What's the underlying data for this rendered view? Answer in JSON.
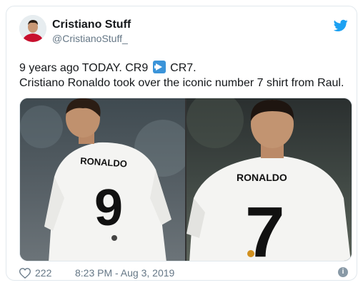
{
  "tweet": {
    "author_name": "Cristiano Stuff",
    "author_handle": "@CristianoStuff_",
    "text_line1_before": "9 years ago TODAY. CR9 ",
    "text_line1_after": " CR7.",
    "text_line2": "Cristiano Ronaldo took over the iconic number 7 shirt from Raul.",
    "emoji": "right-arrow-emoji",
    "likes": "222",
    "timestamp": "8:23 PM - Aug 3, 2019"
  },
  "media": {
    "photo1": {
      "shirt_name": "RONALDO",
      "shirt_number": "9"
    },
    "photo2": {
      "shirt_name": "RONALDO",
      "shirt_number": "7"
    }
  },
  "icons": {
    "brand": "twitter-bird-icon",
    "like": "heart-icon",
    "info": "info-icon"
  },
  "colors": {
    "twitter_blue": "#1da1f2",
    "text": "#14171a",
    "muted": "#657786",
    "border": "#e1e8ed"
  }
}
